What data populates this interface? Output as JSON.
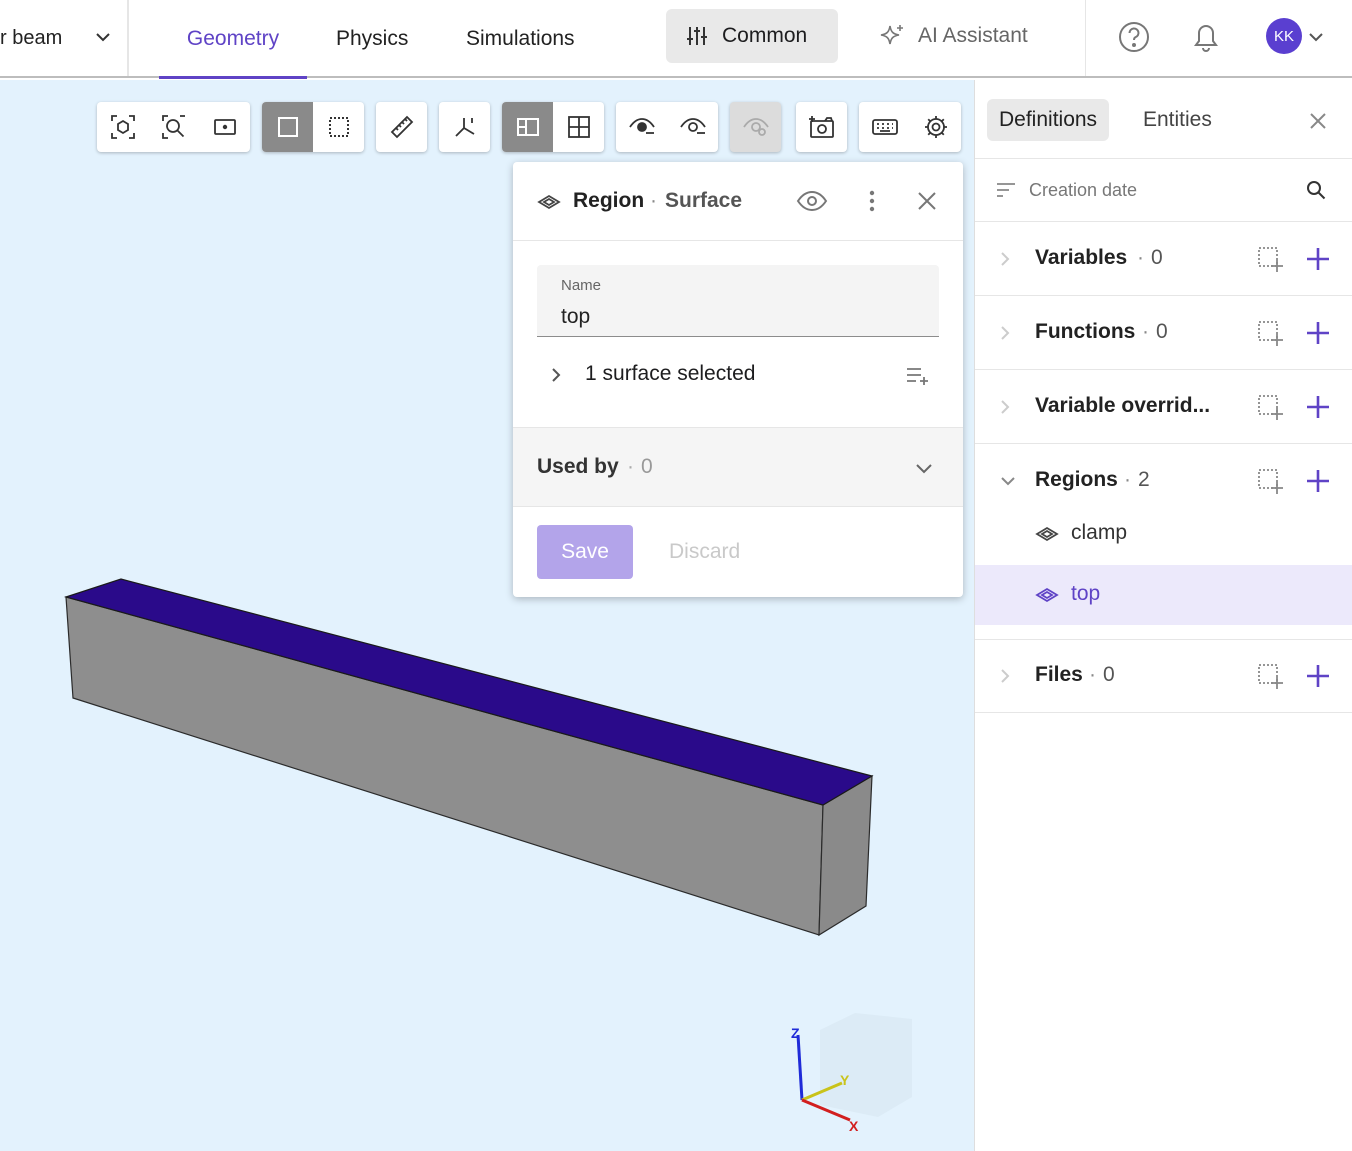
{
  "header": {
    "project_name": "r beam",
    "tabs": [
      {
        "label": "Geometry",
        "active": true
      },
      {
        "label": "Physics",
        "active": false
      },
      {
        "label": "Simulations",
        "active": false
      }
    ],
    "common_label": "Common",
    "ai_label": "AI Assistant",
    "avatar_initials": "KK"
  },
  "viewport": {
    "toolbar_icons": [
      "fit-selection-icon",
      "zoom-fit-icon",
      "focus-icon",
      "box-select-icon",
      "box-deselect-icon",
      "ruler-icon",
      "axes-icon",
      "surface-mode-icon",
      "grid-mode-icon",
      "hide-icon",
      "show-icon",
      "visibility-off-icon",
      "screenshot-icon",
      "keyboard-icon",
      "settings-icon"
    ],
    "axis_labels": {
      "z": "Z",
      "y": "Y",
      "x": "X"
    }
  },
  "region_card": {
    "title": "Region",
    "subtitle": "Surface",
    "name_label": "Name",
    "name_value": "top",
    "selection_text": "1 surface selected",
    "used_by_label": "Used by",
    "used_by_count": "0",
    "save_label": "Save",
    "discard_label": "Discard"
  },
  "sidepanel": {
    "tabs": [
      {
        "label": "Definitions",
        "active": true
      },
      {
        "label": "Entities",
        "active": false
      }
    ],
    "sort_label": "Creation date",
    "sections": [
      {
        "name": "Variables",
        "count": "0"
      },
      {
        "name": "Functions",
        "count": "0"
      },
      {
        "name": "Variable overrid...",
        "count": ""
      },
      {
        "name": "Regions",
        "count": "2"
      },
      {
        "name": "Files",
        "count": "0"
      }
    ],
    "regions": [
      {
        "label": "clamp",
        "selected": false
      },
      {
        "label": "top",
        "selected": true
      }
    ]
  },
  "colors": {
    "accent": "#5f43c6",
    "viewport_bg": "#e3f2fd",
    "beam_top": "#2a0a8a",
    "beam_side": "#8e8e8e"
  }
}
